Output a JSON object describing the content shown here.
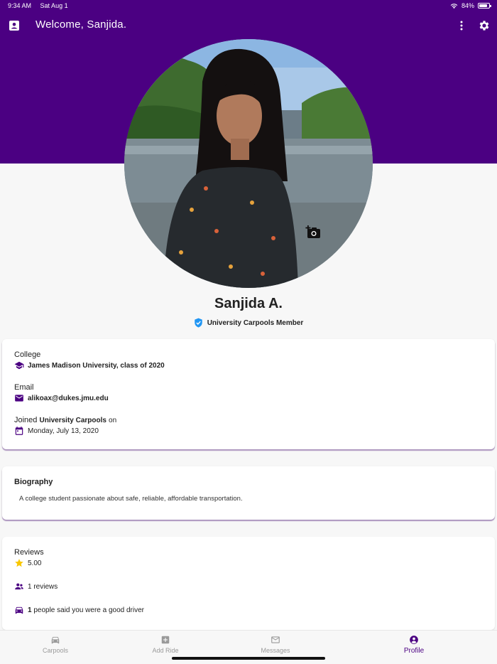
{
  "status_bar": {
    "time": "9:34 AM",
    "date": "Sat Aug 1",
    "battery": "84%",
    "battery_level": 0.84
  },
  "header": {
    "title": "Welcome, Sanjida."
  },
  "profile": {
    "name": "Sanjida A.",
    "badge": "University Carpools Member"
  },
  "info": {
    "college_label": "College",
    "college_value": "James Madison University, class of 2020",
    "email_label": "Email",
    "email_value": "alikoax@dukes.jmu.edu",
    "joined_prefix": "Joined",
    "joined_org": "University Carpools",
    "joined_suffix": "on",
    "joined_date": "Monday, July 13, 2020"
  },
  "biography": {
    "title": "Biography",
    "text": "A college student passionate about safe, reliable, affordable transportation."
  },
  "reviews": {
    "title": "Reviews",
    "rating": "5.00",
    "count_text": "1 reviews",
    "good_driver_count": "1",
    "good_driver_text": "people said you were a good driver"
  },
  "tabs": [
    {
      "label": "Carpools",
      "icon": "car-icon"
    },
    {
      "label": "Add Ride",
      "icon": "add-box-icon"
    },
    {
      "label": "Messages",
      "icon": "mail-icon"
    },
    {
      "label": "Profile",
      "icon": "account-circle-icon"
    }
  ],
  "colors": {
    "primary": "#4b0082",
    "badge_blue": "#2196f3",
    "star": "#f9c700"
  }
}
